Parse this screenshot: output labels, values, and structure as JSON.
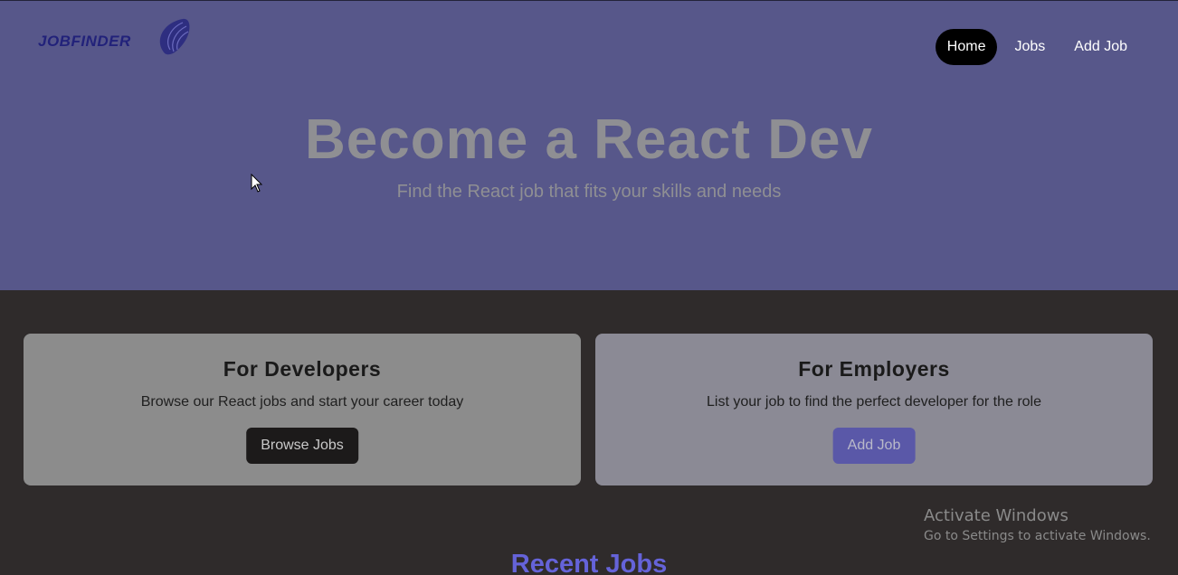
{
  "header": {
    "logo_text": "JOBFINDER",
    "nav": [
      {
        "label": "Home",
        "active": true
      },
      {
        "label": "Jobs",
        "active": false
      },
      {
        "label": "Add Job",
        "active": false
      }
    ]
  },
  "hero": {
    "title": "Become a React Dev",
    "subtitle": "Find the React job that fits your skills and needs"
  },
  "cards": {
    "developers": {
      "title": "For Developers",
      "text": "Browse our React jobs and start your career today",
      "button": "Browse Jobs"
    },
    "employers": {
      "title": "For Employers",
      "text": "List your job to find the perfect developer for the role",
      "button": "Add Job"
    }
  },
  "recent_jobs": {
    "title": "Recent Jobs"
  },
  "watermark": {
    "line1": "Activate Windows",
    "line2": "Go to Settings to activate Windows."
  },
  "colors": {
    "hero_bg": "#57578a",
    "page_bg": "#2f2b2b",
    "accent": "#6563d9",
    "nav_active_bg": "#000000"
  },
  "icons": {
    "logo": "jobfinder-logo",
    "cursor": "mouse-pointer-icon"
  }
}
